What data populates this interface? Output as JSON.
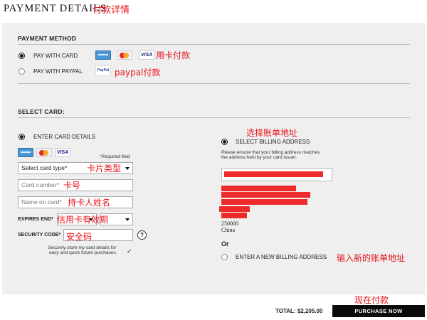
{
  "header": {
    "title": "PAYMENT DETAILS",
    "title_annotation": "付款详情"
  },
  "payment_method": {
    "heading": "PAYMENT METHOD",
    "options": [
      {
        "label": "PAY WITH CARD",
        "selected": true,
        "annotation": "用卡付款",
        "logos": [
          "amex-icon",
          "mastercard-icon",
          "visa-icon"
        ]
      },
      {
        "label": "PAY WITH PAYPAL",
        "selected": false,
        "annotation": "paypal付款",
        "logos": [
          "paypal-icon"
        ]
      }
    ]
  },
  "select_card": {
    "heading": "SELECT CARD:",
    "enter_card_label": "ENTER CARD DETAILS",
    "card_logos": {
      "amex": "AMEX",
      "visa": "VISA",
      "paypal": "PayPal"
    },
    "required_note": "*Required field",
    "card_type": {
      "value": "Select card type*",
      "annotation": "卡片类型"
    },
    "card_number": {
      "placeholder": "Card number*",
      "annotation": "卡号"
    },
    "name_on_card": {
      "placeholder": "Name on card*",
      "annotation": "持卡人姓名"
    },
    "expires": {
      "label": "EXPIRES END*",
      "annotation": "信用卡有效期"
    },
    "security": {
      "label": "SECURITY CODE*",
      "annotation": "安全码",
      "help": "?"
    },
    "store_note_line1": "Securely store my card details for",
    "store_note_line2": "easy and quick future purchases.",
    "store_checked": true,
    "check_mark": "✓"
  },
  "billing": {
    "annotation": "选择账单地址",
    "select_label": "SELECT BILLING ADDRESS",
    "notice_line1": "Please ensure that your billing address matches",
    "notice_line2": "the address held by your card issuer.",
    "postal_code": "250000",
    "country": "China",
    "or": "Or",
    "new_address_label": "ENTER A NEW BILLING ADDRESS",
    "new_address_annotation": "输入新的账单地址"
  },
  "footer": {
    "total_label": "TOTAL:",
    "total_value": "$2,205.00",
    "purchase_label": "PURCHASE NOW",
    "purchase_annotation": "现在付款"
  },
  "colors": {
    "annotation": "#e8141b",
    "redaction": "#ef2a2a",
    "panel": "#efefef",
    "button": "#0a0a0a"
  }
}
